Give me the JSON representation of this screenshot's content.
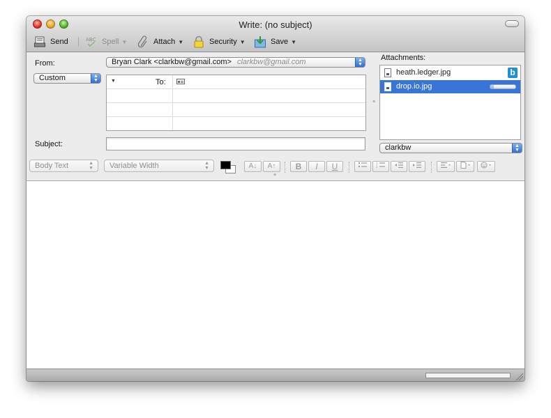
{
  "window": {
    "title": "Write: (no subject)"
  },
  "toolbar": {
    "send": "Send",
    "spell": "Spell",
    "attach": "Attach",
    "security": "Security",
    "save": "Save"
  },
  "header": {
    "from_label": "From:",
    "from_value": "Bryan Clark <clarkbw@gmail.com>",
    "from_hint": "clarkbw@gmail.com",
    "custom_label": "Custom",
    "recipient_type": "To:",
    "subject_label": "Subject:",
    "subject_value": ""
  },
  "attachments": {
    "title": "Attachments:",
    "items": [
      {
        "name": "heath.ledger.jpg",
        "badge": "b",
        "selected": false
      },
      {
        "name": "drop.io.jpg",
        "selected": true,
        "progress": 0.15
      }
    ],
    "account": "clarkbw"
  },
  "format_bar": {
    "paragraph_style": "Body Text",
    "font": "Variable Width",
    "smaller": "A↓",
    "larger": "A↑",
    "bold": "B",
    "italic": "I",
    "underline": "U"
  },
  "colors": {
    "accent": "#3875d7",
    "popup_arrow": "#2f6fd6",
    "badge": "#1e8fd8"
  }
}
